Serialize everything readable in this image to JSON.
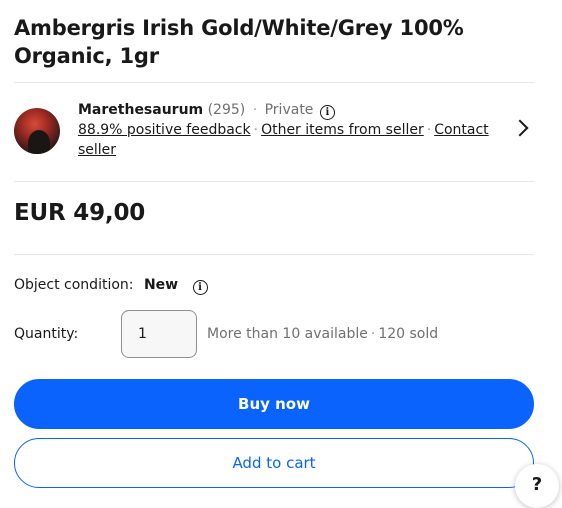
{
  "listing": {
    "title": "Ambergris Irish Gold/White/Grey 100% Organic, 1gr"
  },
  "seller": {
    "name": "Marethesaurum",
    "feedback_count": "(295)",
    "type": "Private",
    "positive_feedback": "88.9% positive feedback",
    "other_items": "Other items from seller",
    "contact": "Contact seller"
  },
  "price": {
    "text": "EUR 49,00"
  },
  "condition": {
    "label": "Object condition:",
    "value": "New"
  },
  "quantity": {
    "label": "Quantity:",
    "value": "1",
    "availability": "More than 10 available",
    "sold": "120 sold"
  },
  "actions": {
    "buy_now": "Buy now",
    "add_to_cart": "Add to cart"
  },
  "help": {
    "label": "?"
  },
  "colors": {
    "accent": "#0a63fd",
    "text": "#191919",
    "muted": "#707070"
  },
  "icons": {
    "info": "info-circle-icon",
    "chevron": "chevron-right-icon",
    "avatar": "seller-avatar"
  }
}
